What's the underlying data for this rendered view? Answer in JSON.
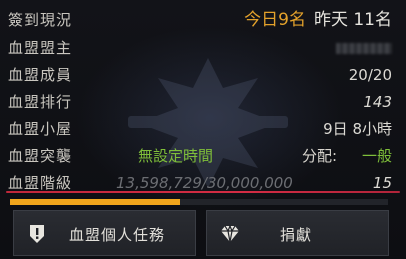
{
  "checkin": {
    "label": "簽到現況",
    "today": "今日9名",
    "yesterday": "昨天 11名"
  },
  "leader": {
    "label": "血盟盟主"
  },
  "members": {
    "label": "血盟成員",
    "value": "20/20"
  },
  "ranking": {
    "label": "血盟排行",
    "value": "143"
  },
  "house": {
    "label": "血盟小屋",
    "value": "9日 8小時"
  },
  "raid": {
    "label": "血盟突襲",
    "status": "無設定時間",
    "split_label": "分配:",
    "split_value": "一般"
  },
  "level": {
    "label": "血盟階級",
    "exp": "13,598,729/30,000,000",
    "value": "15",
    "progress": 0.45
  },
  "buttons": {
    "quest": "血盟個人任務",
    "donate": "捐獻"
  },
  "colors": {
    "today": "#e3a12b",
    "green": "#7fbf3a",
    "bar": "#f0a51c",
    "underline": "#d42c44"
  },
  "icons": {
    "quest": "shield-alert-icon",
    "donate": "diamond-icon",
    "emblem": "clan-emblem"
  }
}
